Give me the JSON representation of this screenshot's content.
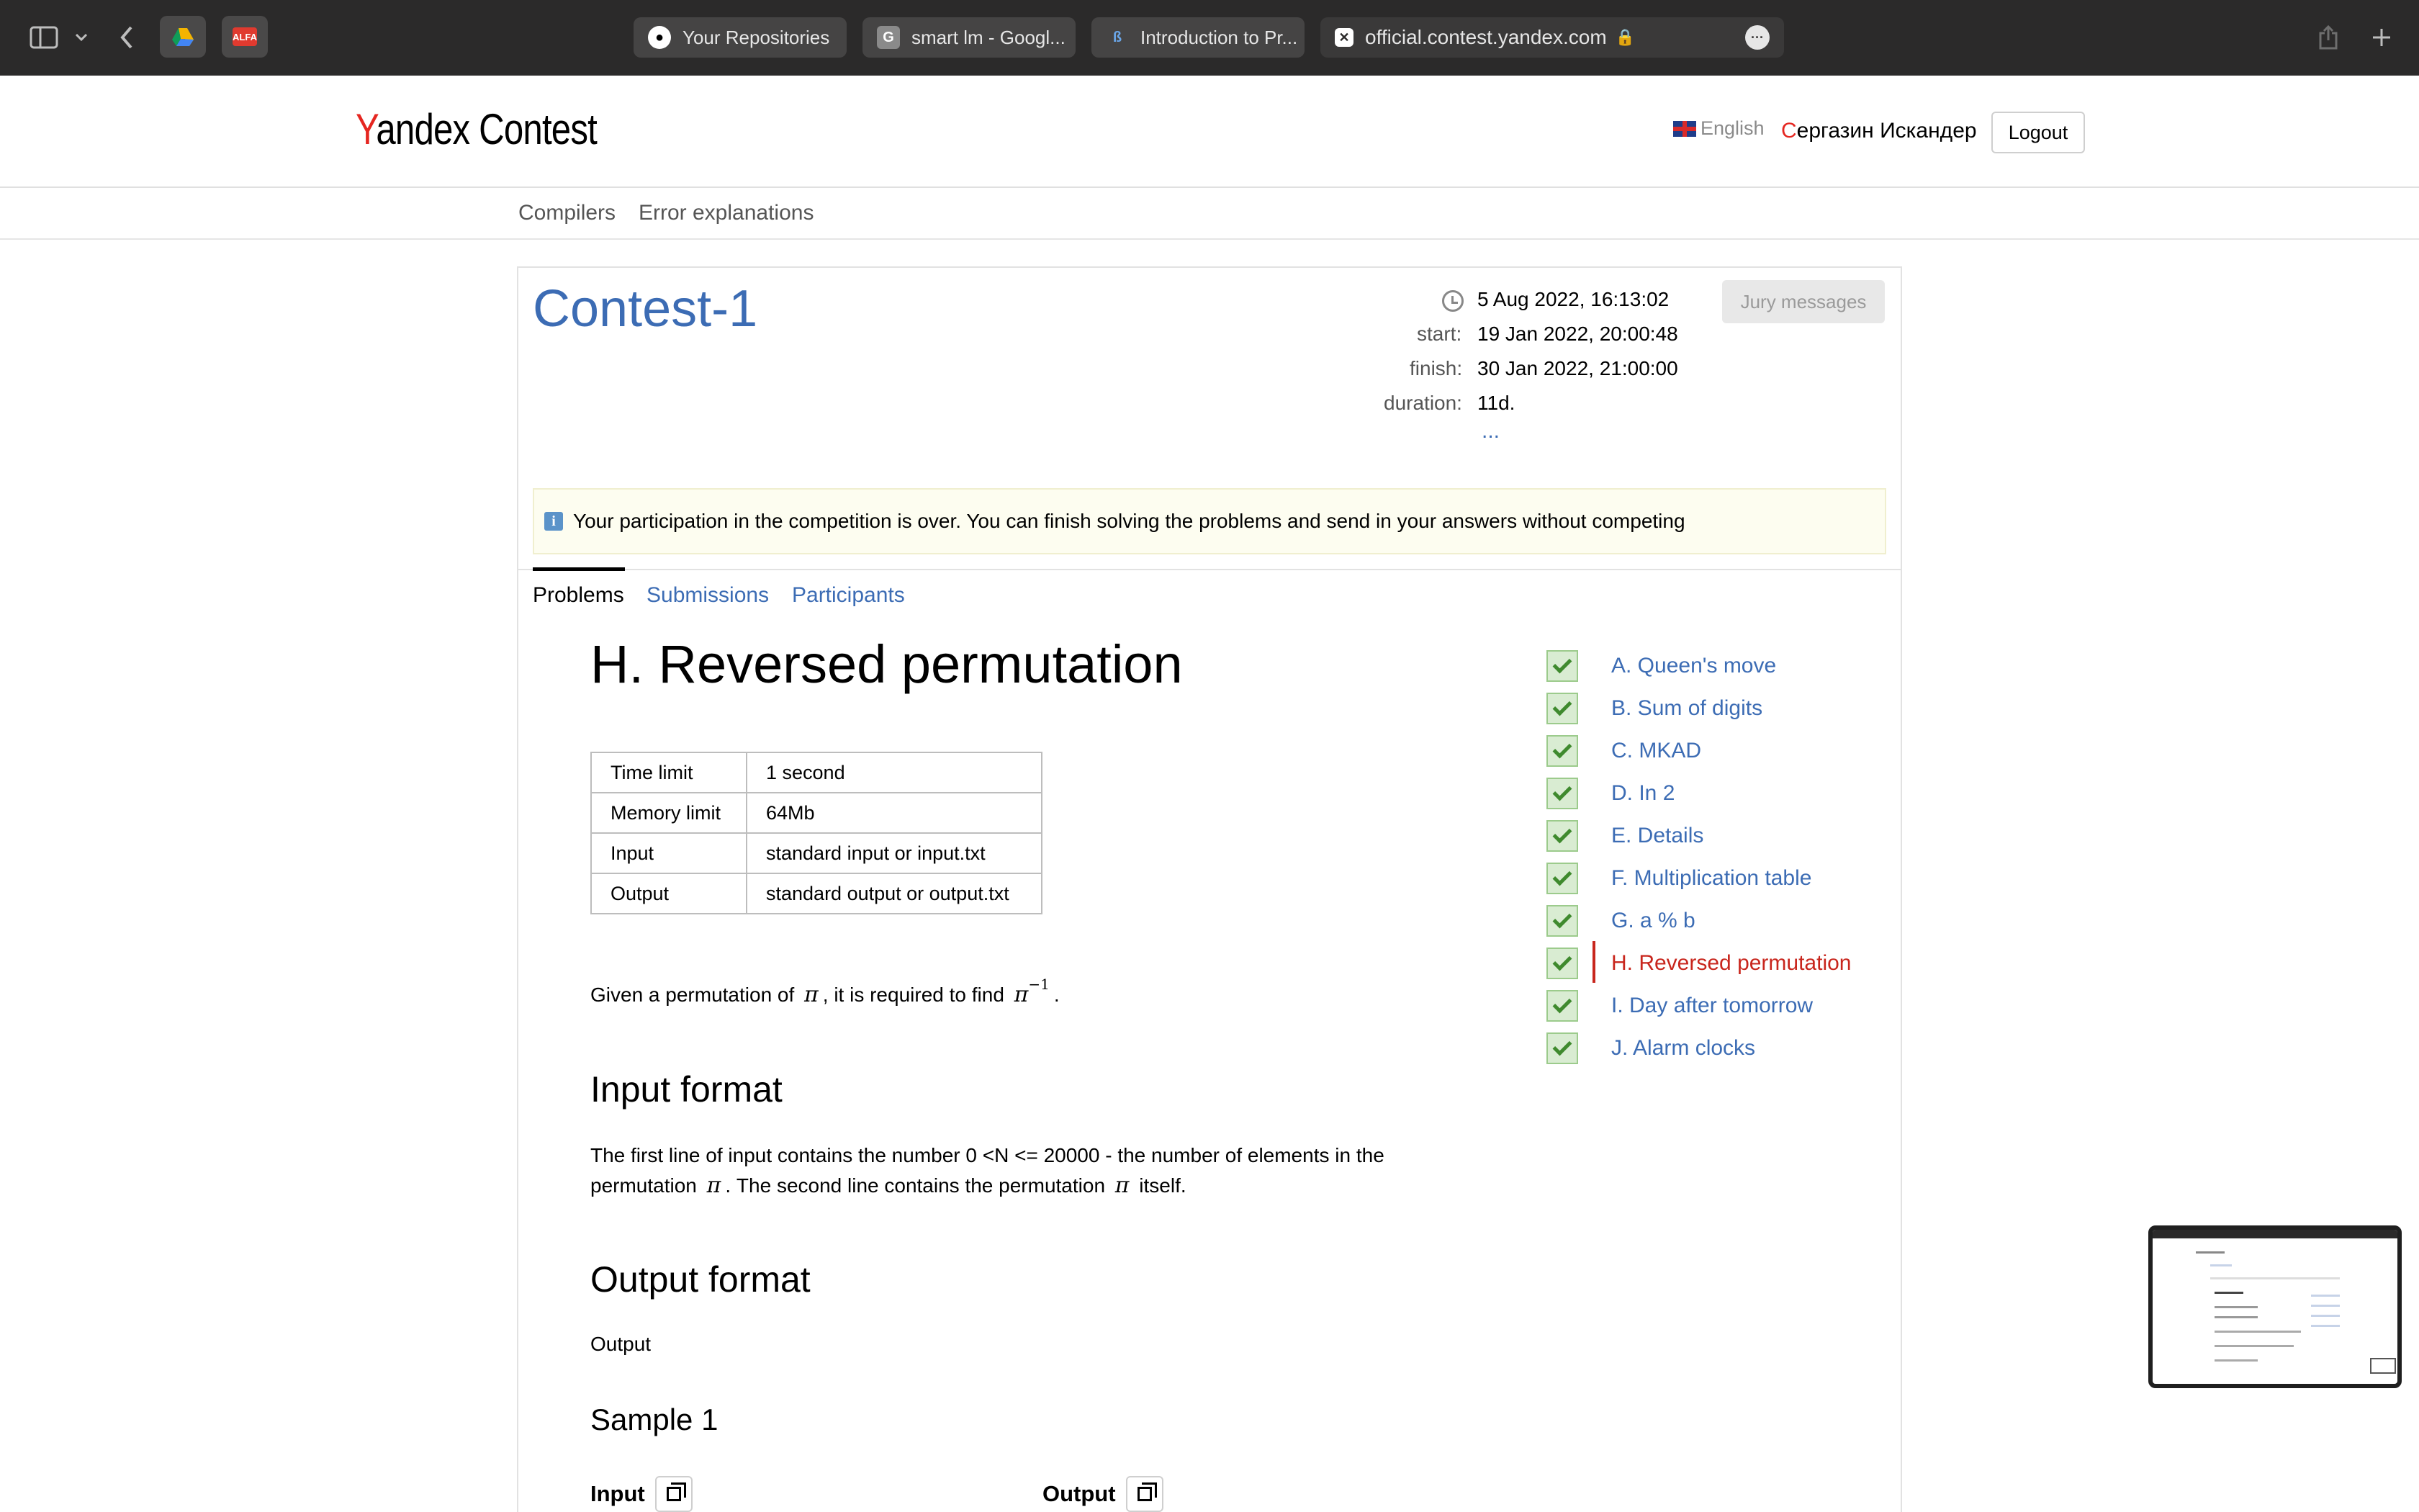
{
  "browser": {
    "tabs": [
      {
        "label": "Your Repositories",
        "icon": "github-icon"
      },
      {
        "label": "smart lm - Googl...",
        "icon": "google-g-icon"
      },
      {
        "label": "Introduction to Pr...",
        "icon": "document-icon"
      }
    ],
    "address": "official.contest.yandex.com"
  },
  "header": {
    "logo_y": "Y",
    "logo_rest": "andex",
    "logo_contest": " Contest",
    "language": "English",
    "user_first": "С",
    "user_rest": "ергазин Искандер",
    "logout": "Logout"
  },
  "subnav": {
    "compilers": "Compilers",
    "errors": "Error explanations"
  },
  "contest": {
    "title": "Contest-1",
    "current_time": "5 Aug 2022, 16:13:02",
    "start_label": "start:",
    "start": "19 Jan 2022, 20:00:48",
    "finish_label": "finish:",
    "finish": "30 Jan 2022, 21:00:00",
    "duration_label": "duration:",
    "duration": "11d.",
    "more": "...",
    "jury_button": "Jury messages",
    "notice": "Your participation in the competition is over. You can finish solving the problems and send in your answers without competing"
  },
  "tabs": {
    "problems": "Problems",
    "submissions": "Submissions",
    "participants": "Participants"
  },
  "problem": {
    "title": "H. Reversed permutation",
    "limits": [
      {
        "k": "Time limit",
        "v": "1 second"
      },
      {
        "k": "Memory limit",
        "v": "64Mb"
      },
      {
        "k": "Input",
        "v": "standard input or input.txt"
      },
      {
        "k": "Output",
        "v": "standard output or output.txt"
      }
    ],
    "statement_a": "Given a permutation of ",
    "pi": "π",
    "statement_b": ", it is required to find ",
    "inv_sup": "−1",
    "statement_c": ".",
    "input_heading": "Input format",
    "input_a": "The first line of input contains the number 0 <N <= 20000 - the number of elements in the",
    "input_b": "permutation ",
    "input_c": ". The second line contains the permutation ",
    "input_d": " itself.",
    "output_heading": "Output format",
    "output_text": "Output",
    "sample_heading": "Sample 1",
    "sample_input": "Input",
    "sample_output": "Output"
  },
  "problem_list": [
    {
      "label": "A. Queen's move",
      "solved": true
    },
    {
      "label": "B. Sum of digits",
      "solved": true
    },
    {
      "label": "C. MKAD",
      "solved": true
    },
    {
      "label": "D. In 2",
      "solved": true
    },
    {
      "label": "E. Details",
      "solved": true
    },
    {
      "label": "F. Multiplication table",
      "solved": true
    },
    {
      "label": "G. a % b",
      "solved": true
    },
    {
      "label": "H. Reversed permutation",
      "solved": true,
      "current": true
    },
    {
      "label": "I. Day after tomorrow",
      "solved": true
    },
    {
      "label": "J. Alarm clocks",
      "solved": true
    }
  ],
  "colors": {
    "link": "#3c6cb4",
    "accent_red": "#c8261d",
    "check_bg": "#d9ecd2"
  }
}
